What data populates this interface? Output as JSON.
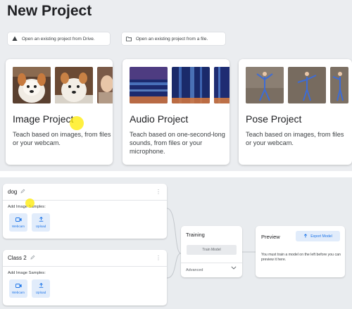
{
  "page_title": "New Project",
  "open_drive": {
    "label": "Open an existing project from Drive.",
    "icon": "drive-icon"
  },
  "open_file": {
    "label": "Open an existing project from a file.",
    "icon": "folder-icon"
  },
  "cards": [
    {
      "title": "Image Project",
      "description": "Teach based on images, from files or your webcam."
    },
    {
      "title": "Audio Project",
      "description": "Teach based on one-second-long sounds, from files or your microphone."
    },
    {
      "title": "Pose Project",
      "description": "Teach based on images, from files or your webcam."
    }
  ],
  "classes": [
    {
      "name": "dog",
      "add_label": "Add Image Samples:",
      "webcam_label": "Webcam",
      "upload_label": "Upload"
    },
    {
      "name": "Class 2",
      "add_label": "Add Image Samples:",
      "webcam_label": "Webcam",
      "upload_label": "Upload"
    }
  ],
  "training": {
    "title": "Training",
    "button": "Train Model",
    "advanced": "Advanced"
  },
  "preview": {
    "title": "Preview",
    "export": "Export Model",
    "message": "You must train a model on the left before you can preview it here."
  },
  "colors": {
    "accent": "#1a73e8",
    "accent_bg": "#e1ecfb",
    "highlight": "#ffeb00"
  }
}
